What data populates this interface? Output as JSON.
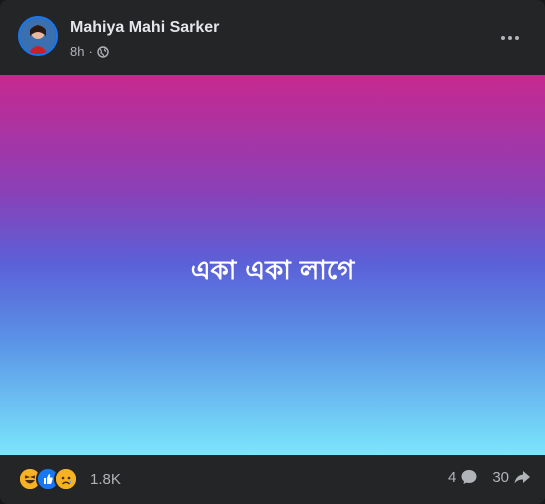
{
  "post": {
    "author": "Mahiya Mahi Sarker",
    "time": "8h",
    "separator": "·",
    "privacy_icon": "globe-icon",
    "more_icon": "more-options-icon",
    "text": "একা একা লাগে",
    "background_gradient": [
      "#c7288f",
      "#5b61d8",
      "#7be6fc"
    ]
  },
  "footer": {
    "reaction_icons": [
      "haha-icon",
      "like-icon",
      "sad-icon"
    ],
    "reaction_count": "1.8K",
    "comment_count": "4",
    "comment_icon": "comment-icon",
    "share_count": "30",
    "share_icon": "share-icon"
  },
  "colors": {
    "card_bg": "#242526",
    "text_primary": "#e4e6eb",
    "text_secondary": "#b0b3b8",
    "like_blue": "#1877f2",
    "emoji_yellow": "#f7b125"
  }
}
